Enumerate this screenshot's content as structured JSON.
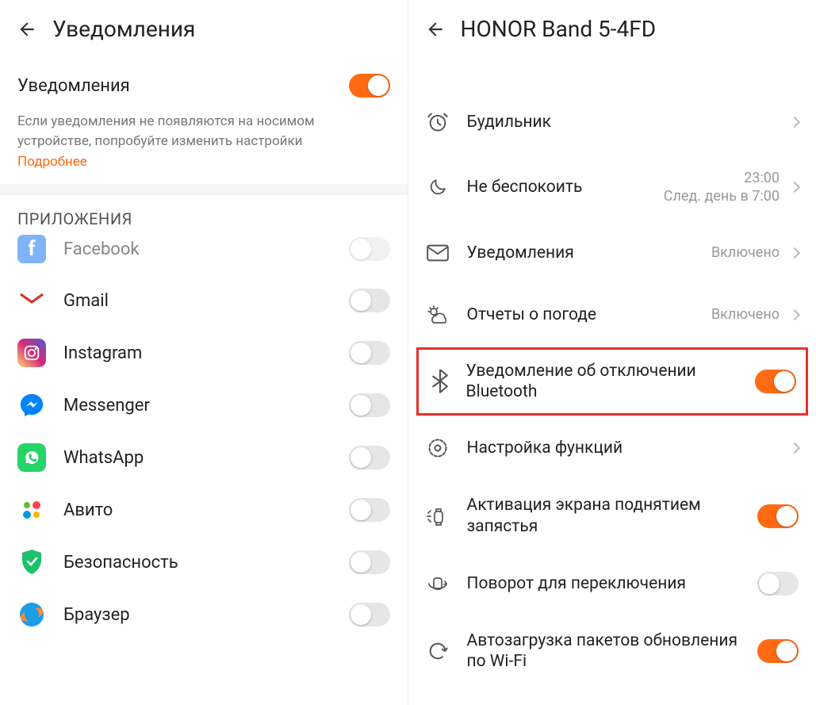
{
  "left": {
    "title": "Уведомления",
    "toggleRow": {
      "label": "Уведомления",
      "on": true
    },
    "helpText": "Если уведомления не появляются на носимом устройстве, попробуйте изменить настройки",
    "helpLink": "Подробнее",
    "sectionTitle": "ПРИЛОЖЕНИЯ",
    "apps": [
      {
        "icon": "facebook",
        "label": "Facebook",
        "on": false
      },
      {
        "icon": "gmail",
        "label": "Gmail",
        "on": false
      },
      {
        "icon": "instagram",
        "label": "Instagram",
        "on": false
      },
      {
        "icon": "messenger",
        "label": "Messenger",
        "on": false
      },
      {
        "icon": "whatsapp",
        "label": "WhatsApp",
        "on": false
      },
      {
        "icon": "avito",
        "label": "Авито",
        "on": false
      },
      {
        "icon": "security",
        "label": "Безопасность",
        "on": false
      },
      {
        "icon": "browser",
        "label": "Браузер",
        "on": false
      }
    ]
  },
  "right": {
    "title": "HONOR Band 5-4FD",
    "rows": [
      {
        "icon": "alarm",
        "label": "Будильник",
        "type": "nav"
      },
      {
        "icon": "moon",
        "label": "Не беспокоить",
        "type": "nav",
        "valueLine1": "23:00",
        "valueLine2": "След. день в 7:00"
      },
      {
        "icon": "mail",
        "label": "Уведомления",
        "type": "nav",
        "valueLine1": "Включено"
      },
      {
        "icon": "weather",
        "label": "Отчеты о погоде",
        "type": "nav",
        "valueLine1": "Включено"
      },
      {
        "icon": "bluetooth",
        "label": "Уведомление об отключении Bluetooth",
        "type": "toggle",
        "on": true,
        "highlight": true
      },
      {
        "icon": "gear",
        "label": "Настройка функций",
        "type": "nav"
      },
      {
        "icon": "wrist",
        "label": "Активация экрана поднятием запястья",
        "type": "toggle",
        "on": true
      },
      {
        "icon": "rotate",
        "label": "Поворот для переключения",
        "type": "toggle",
        "on": false
      },
      {
        "icon": "refresh",
        "label": "Автозагрузка пакетов обновления по Wi-Fi",
        "type": "toggle",
        "on": true
      }
    ]
  }
}
